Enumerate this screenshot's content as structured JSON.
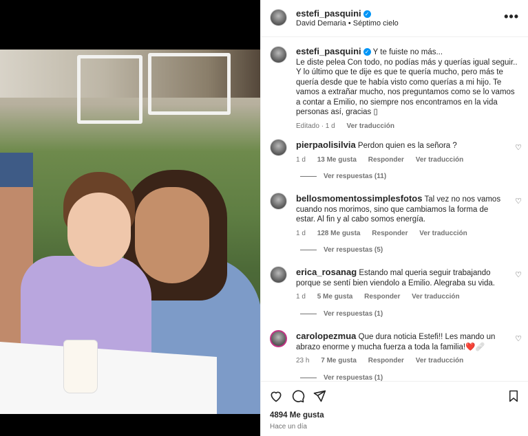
{
  "post": {
    "username": "estefi_pasquini",
    "subtitle_artist": "David Demaria",
    "subtitle_sep": "•",
    "subtitle_song": "Séptimo cielo",
    "more_label": "•••"
  },
  "caption": {
    "username": "estefi_pasquini",
    "text_line1": "Y te fuiste no más...",
    "text_rest": "Le diste pelea Con todo, no podías más y querías igual seguir.. Y lo último que te dije es que te quería mucho, pero más te quería desde que te había visto como querías a mi hijo. Te vamos a extrañar mucho, nos preguntamos como se lo vamos a contar a Emilio, no siempre nos encontramos en la vida personas así, gracias ▯",
    "edited": "Editado · 1 d",
    "translate": "Ver traducción"
  },
  "comments": [
    {
      "username": "pierpaolisilvia",
      "text": "Perdon quien es la señora ?",
      "time": "1 d",
      "likes": "13 Me gusta",
      "reply": "Responder",
      "translate": "Ver traducción",
      "replies": "Ver respuestas (11)"
    },
    {
      "username": "bellosmomentossimplesfotos",
      "text": "Tal vez no nos vamos cuando nos morimos, sino que cambiamos la forma de estar. Al fin y al cabo somos energía.",
      "time": "1 d",
      "likes": "128 Me gusta",
      "reply": "Responder",
      "translate": "Ver traducción",
      "replies": "Ver respuestas (5)"
    },
    {
      "username": "erica_rosanag",
      "text": "Estando mal queria seguir trabajando porque se sentí bien viendolo a Emilio. Alegraba su vida.",
      "time": "1 d",
      "likes": "5 Me gusta",
      "reply": "Responder",
      "translate": "Ver traducción",
      "replies": "Ver respuestas (1)"
    },
    {
      "username": "carolopezmua",
      "text": "Que dura noticia Estefi!! Les mando un abrazo enorme y mucha fuerza a toda la familia!❤️🩹",
      "time": "23 h",
      "likes": "7 Me gusta",
      "reply": "Responder",
      "translate": "Ver traducción",
      "replies": "Ver respuestas (1)"
    }
  ],
  "footer": {
    "likes": "4894 Me gusta",
    "time": "Hace un día"
  },
  "icons": [
    "heart-icon",
    "comment-icon",
    "share-icon",
    "bookmark-icon",
    "more-icon",
    "verified-icon"
  ],
  "colors": {
    "verified": "#0095f6",
    "muted": "#737373",
    "text": "#262626"
  }
}
